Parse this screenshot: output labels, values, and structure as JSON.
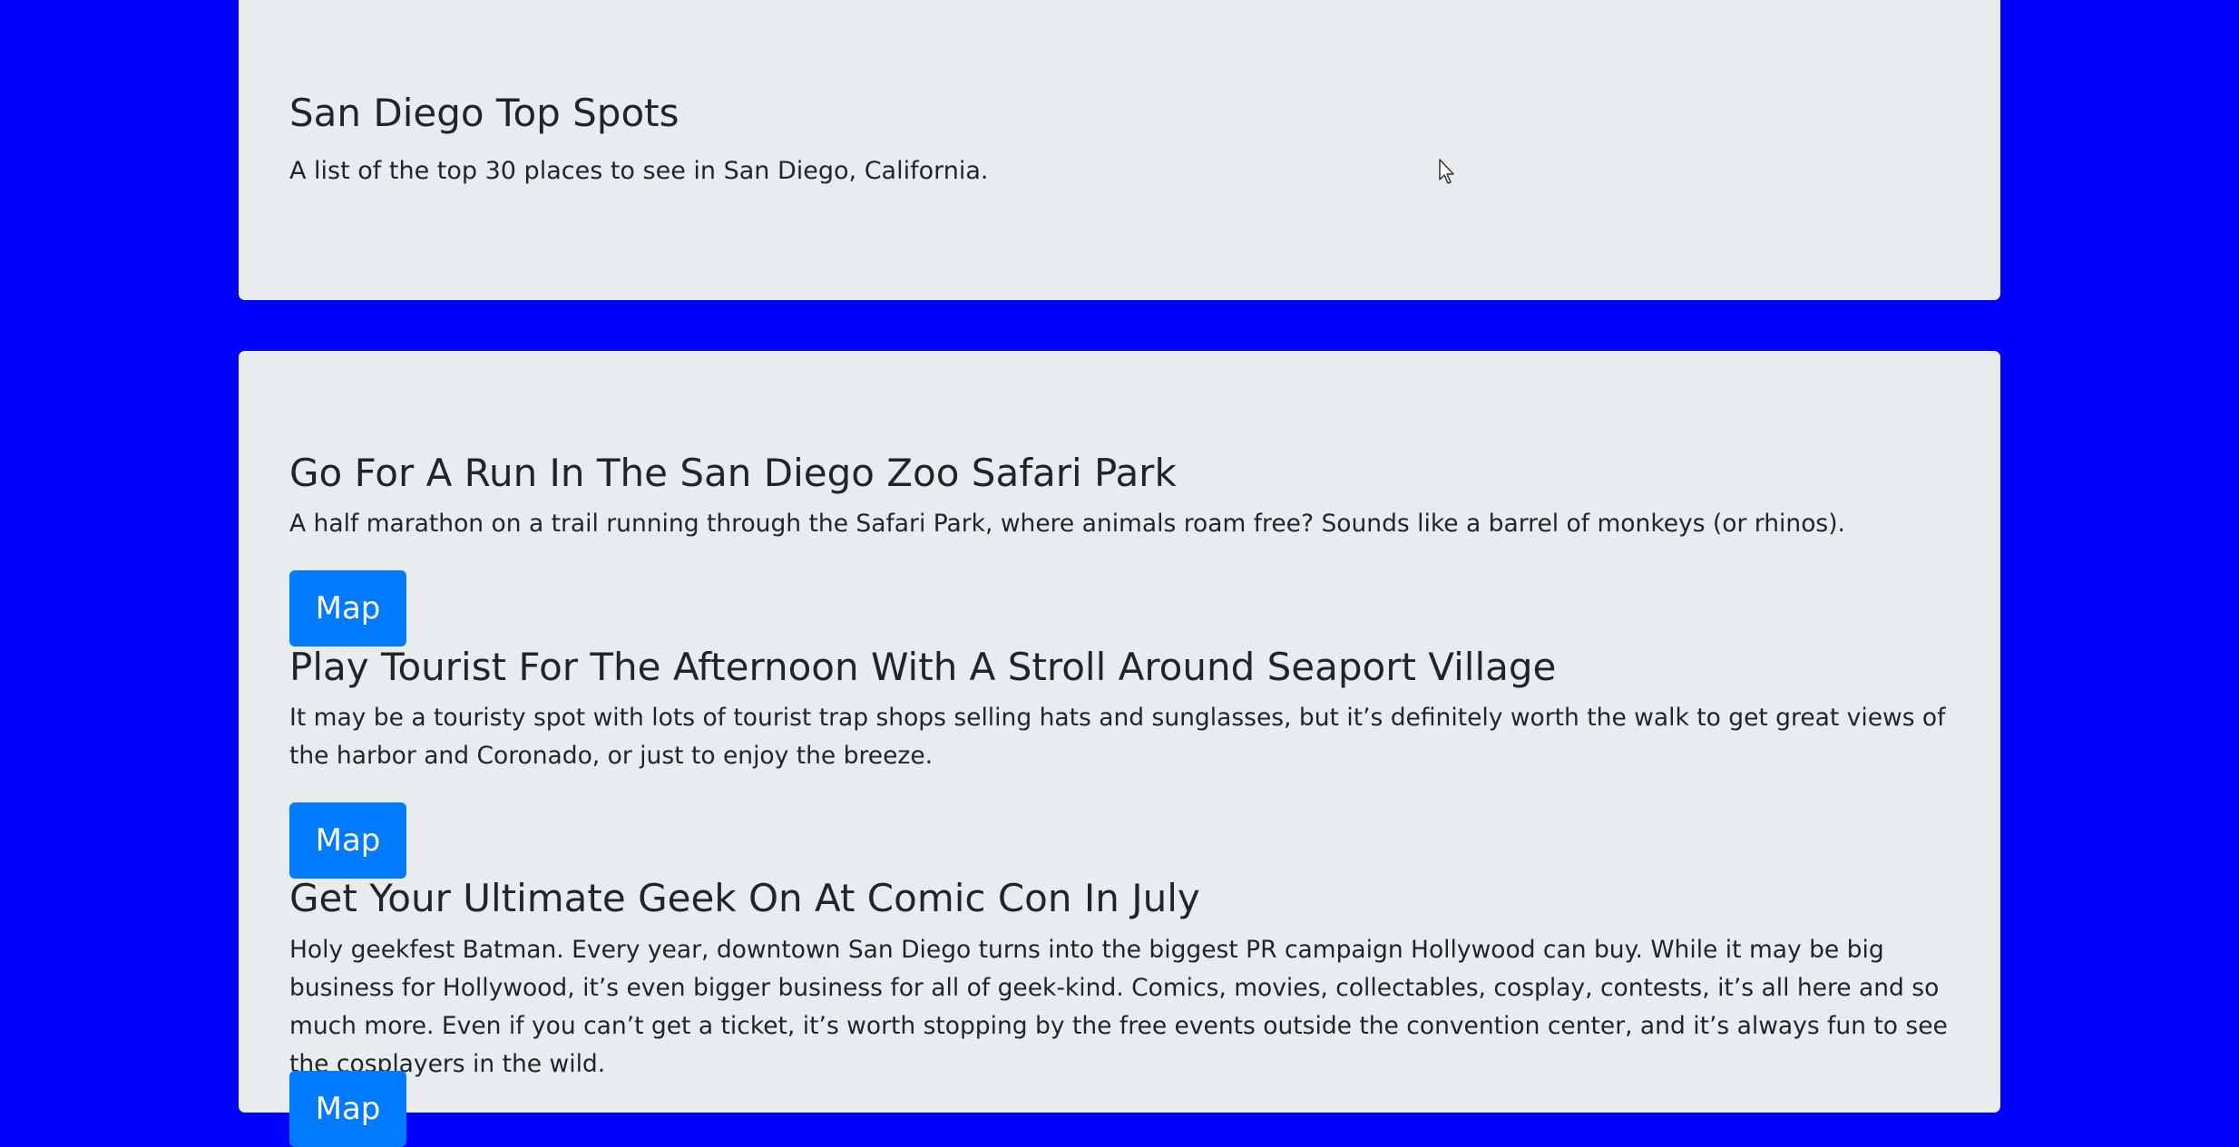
{
  "header": {
    "title": "San Diego Top Spots",
    "lead": "A list of the top 30 places to see in San Diego, California."
  },
  "spots": [
    {
      "title": "Go For A Run In The San Diego Zoo Safari Park",
      "description": "A half marathon on a trail running through the Safari Park, where animals roam free? Sounds like a barrel of monkeys (or rhinos).",
      "button_label": "Map"
    },
    {
      "title": "Play Tourist For The Afternoon With A Stroll Around Seaport Village",
      "description": "It may be a touristy spot with lots of tourist trap shops selling hats and sunglasses, but it’s definitely worth the walk to get great views of the harbor and Coronado, or just to enjoy the breeze.",
      "button_label": "Map"
    },
    {
      "title": "Get Your Ultimate Geek On At Comic Con In July",
      "description": "Holy geekfest Batman. Every year, downtown San Diego turns into the biggest PR campaign Hollywood can buy. While it may be big business for Hollywood, it’s even bigger business for all of geek-kind. Comics, movies, collectables, cosplay, contests, it’s all here and so much more. Even if you can’t get a ticket, it’s worth stopping by the free events outside the convention center, and it’s always fun to see the cosplayers in the wild.",
      "button_label": "Map"
    }
  ],
  "colors": {
    "page_background": "#0000ff",
    "card_background": "#e9ecef",
    "button_background": "#007bff",
    "text": "#212529"
  }
}
